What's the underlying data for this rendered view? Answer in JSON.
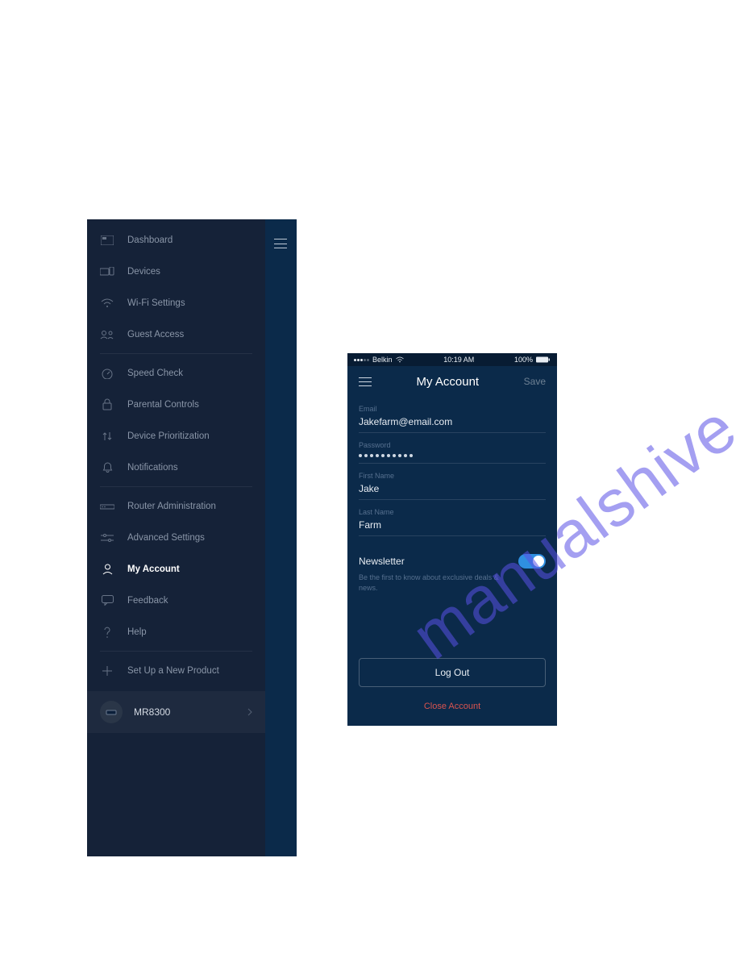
{
  "watermark": "manualshive.com",
  "sidebar": {
    "items": [
      {
        "label": "Dashboard"
      },
      {
        "label": "Devices"
      },
      {
        "label": "Wi-Fi Settings"
      },
      {
        "label": "Guest Access"
      },
      {
        "label": "Speed Check"
      },
      {
        "label": "Parental Controls"
      },
      {
        "label": "Device Prioritization"
      },
      {
        "label": "Notifications"
      },
      {
        "label": "Router Administration"
      },
      {
        "label": "Advanced Settings"
      },
      {
        "label": "My Account"
      },
      {
        "label": "Feedback"
      },
      {
        "label": "Help"
      },
      {
        "label": "Set Up a New Product"
      }
    ],
    "device": {
      "name": "MR8300"
    }
  },
  "account": {
    "status": {
      "carrier": "Belkin",
      "time": "10:19 AM",
      "battery": "100%"
    },
    "nav": {
      "title": "My Account",
      "save": "Save"
    },
    "fields": {
      "email_label": "Email",
      "email": "Jakefarm@email.com",
      "password_label": "Password",
      "firstname_label": "First Name",
      "firstname": "Jake",
      "lastname_label": "Last Name",
      "lastname": "Farm"
    },
    "newsletter": {
      "label": "Newsletter",
      "desc": "Be the first to know about exclusive deals & news."
    },
    "logout": "Log Out",
    "close": "Close Account"
  }
}
